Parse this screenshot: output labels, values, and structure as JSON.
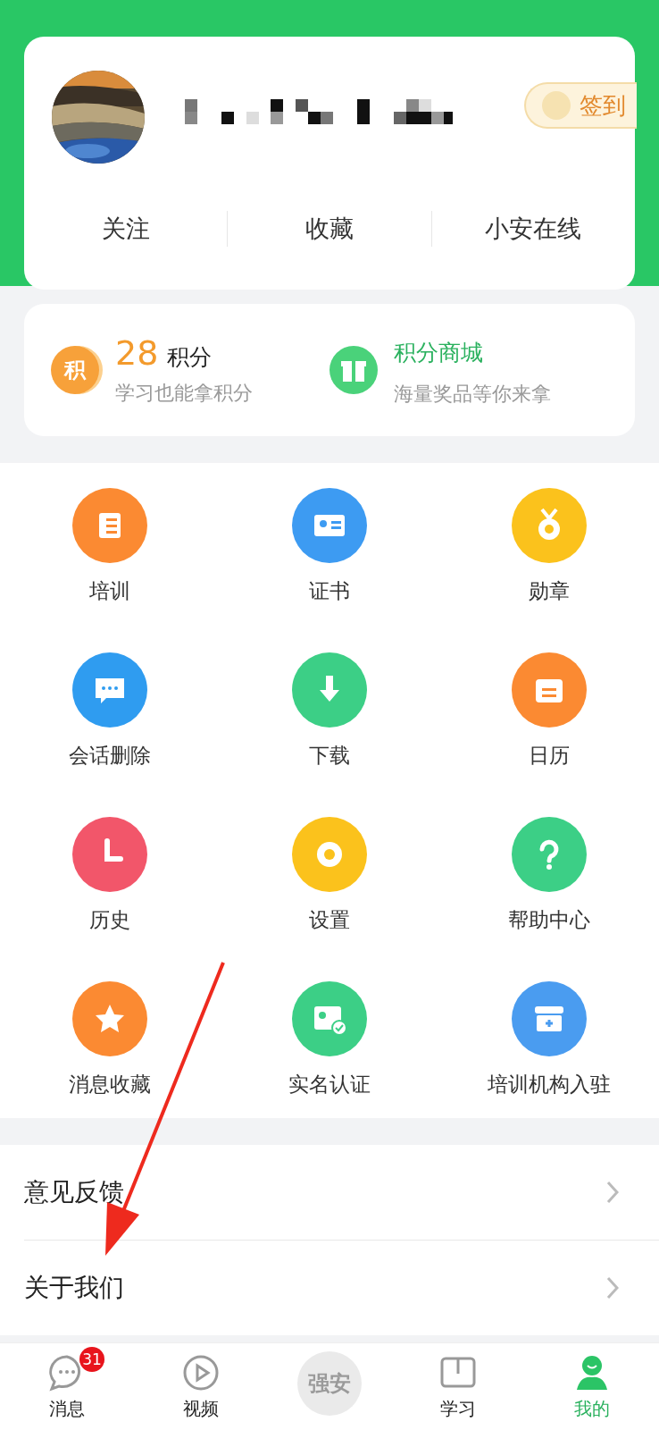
{
  "profile": {
    "signin_button": "签到",
    "tabs": [
      "关注",
      "收藏",
      "小安在线"
    ]
  },
  "points": {
    "value": "28",
    "unit": "积分",
    "badge": "积",
    "subtitle": "学习也能拿积分",
    "mall_title": "积分商城",
    "mall_subtitle": "海量奖品等你来拿"
  },
  "grid": [
    {
      "label": "培训",
      "color": "#fb8a32"
    },
    {
      "label": "证书",
      "color": "#3d9bf2"
    },
    {
      "label": "勋章",
      "color": "#fbc21c"
    },
    {
      "label": "会话删除",
      "color": "#2f9cf0"
    },
    {
      "label": "下载",
      "color": "#3ccf86"
    },
    {
      "label": "日历",
      "color": "#fb8a32"
    },
    {
      "label": "历史",
      "color": "#f2566a"
    },
    {
      "label": "设置",
      "color": "#fbc21c"
    },
    {
      "label": "帮助中心",
      "color": "#3ccf86"
    },
    {
      "label": "消息收藏",
      "color": "#fb8a32"
    },
    {
      "label": "实名认证",
      "color": "#3ccf86"
    },
    {
      "label": "培训机构入驻",
      "color": "#4a9cf0"
    }
  ],
  "list": [
    "意见反馈",
    "关于我们"
  ],
  "nav": [
    {
      "label": "消息",
      "kind": "chat",
      "badge": "31",
      "selected": false
    },
    {
      "label": "视频",
      "kind": "play",
      "selected": false
    },
    {
      "label": "强安",
      "kind": "logo",
      "selected": false
    },
    {
      "label": "学习",
      "kind": "book",
      "selected": false
    },
    {
      "label": "我的",
      "kind": "person",
      "selected": true
    }
  ]
}
